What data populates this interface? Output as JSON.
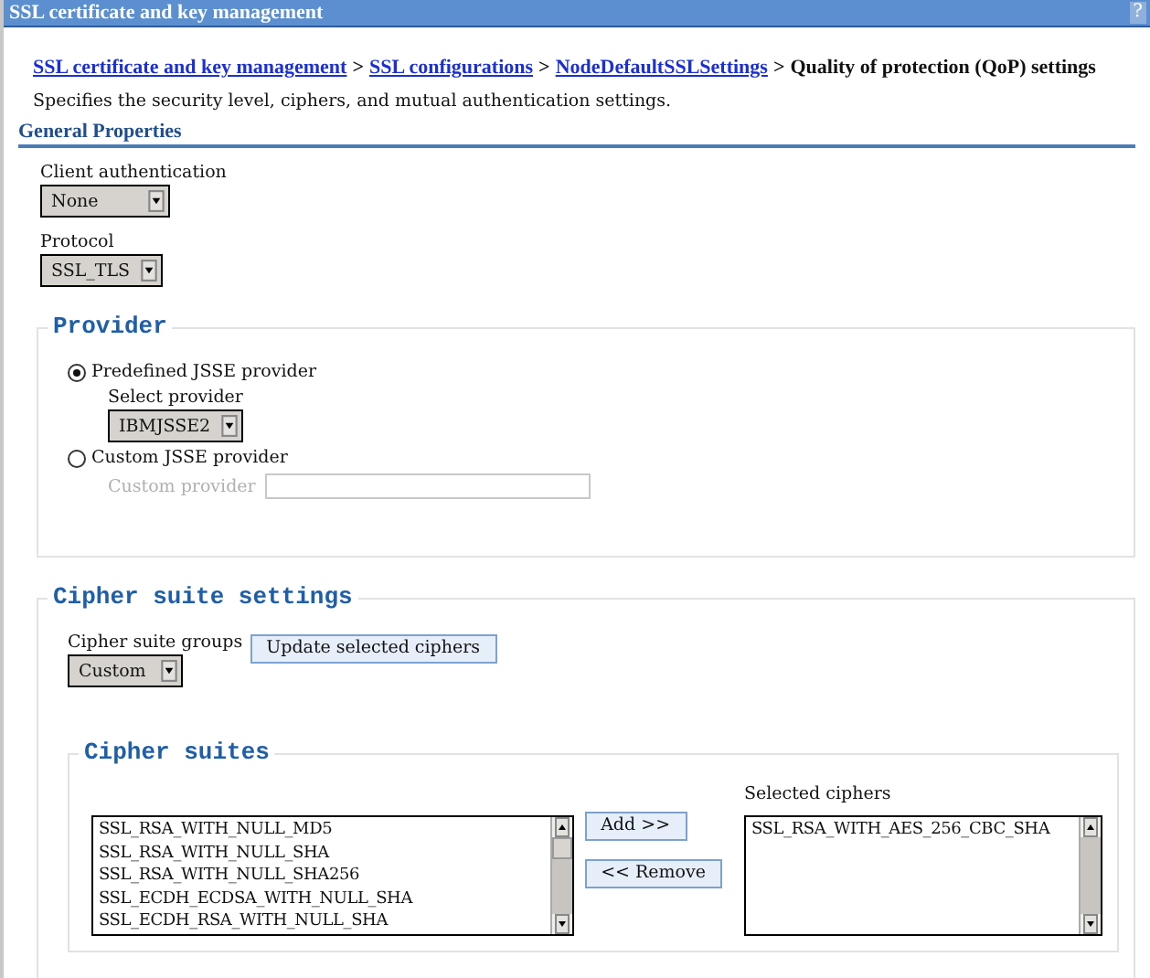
{
  "window": {
    "title": "SSL certificate and key management",
    "help": "?"
  },
  "breadcrumb": [
    {
      "kind": "link",
      "text": "SSL certificate and key management"
    },
    {
      "kind": "separator",
      "text": ">"
    },
    {
      "kind": "link",
      "text": "SSL configurations"
    },
    {
      "kind": "separator",
      "text": ">"
    },
    {
      "kind": "link",
      "text": "NodeDefaultSSLSettings"
    },
    {
      "kind": "separator",
      "text": ">"
    },
    {
      "kind": "current",
      "text": "Quality of protection (QoP) settings"
    }
  ],
  "description": "Specifies the security level, ciphers, and mutual authentication settings.",
  "section_title": "General Properties",
  "client_authentication": {
    "label": "Client authentication",
    "value": "None"
  },
  "protocol": {
    "label": "Protocol",
    "value": "SSL_TLS"
  },
  "provider": {
    "legend": "Provider",
    "options": [
      {
        "label": "Predefined JSSE provider",
        "selected": true
      },
      {
        "label": "Custom JSSE provider",
        "selected": false
      }
    ],
    "select_provider": {
      "label": "Select provider",
      "value": "IBMJSSE2"
    },
    "custom_provider": {
      "label": "Custom provider",
      "disabled": true
    }
  },
  "cipher_suite_settings": {
    "legend": "Cipher suite settings",
    "groups": {
      "label": "Cipher suite groups",
      "value": "Custom"
    },
    "update_button": "Update selected ciphers",
    "cipher_suites": {
      "legend": "Cipher suites",
      "available": [
        "SSL_RSA_WITH_NULL_MD5",
        "SSL_RSA_WITH_NULL_SHA",
        "SSL_RSA_WITH_NULL_SHA256",
        "SSL_ECDH_ECDSA_WITH_NULL_SHA",
        "SSL_ECDH_RSA_WITH_NULL_SHA"
      ],
      "add_button": "Add >>",
      "remove_button": "<< Remove",
      "selected_label": "Selected ciphers",
      "selected": [
        "SSL_RSA_WITH_AES_256_CBC_SHA"
      ]
    }
  }
}
